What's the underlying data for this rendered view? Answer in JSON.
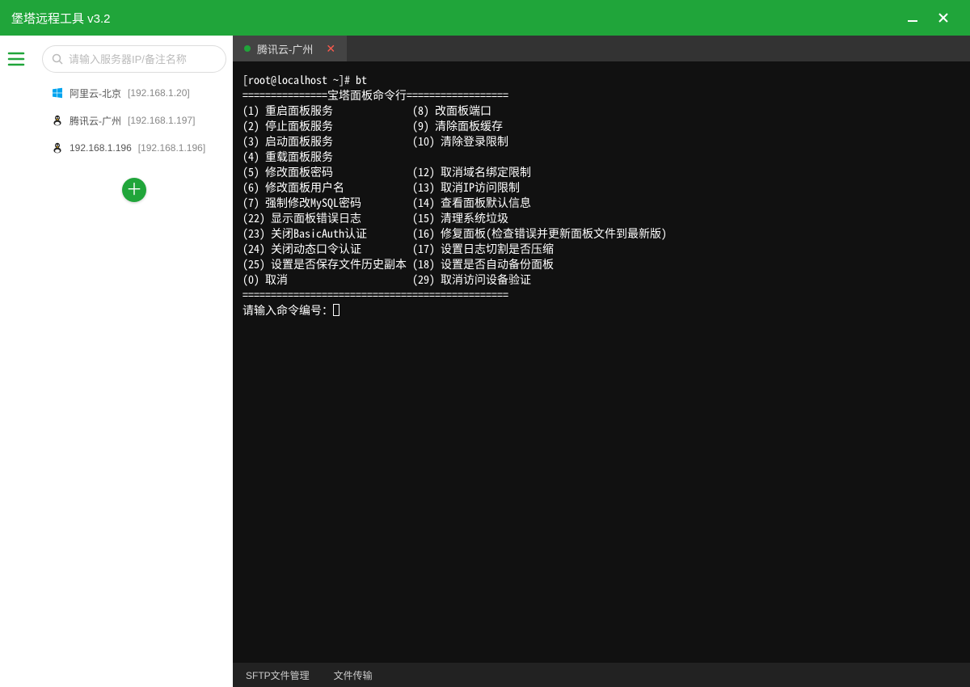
{
  "colors": {
    "accent": "#20a53a",
    "term_bg": "#111111"
  },
  "titlebar": {
    "title": "堡塔远程工具 v3.2"
  },
  "search": {
    "placeholder": "请输入服务器IP/备注名称"
  },
  "servers": [
    {
      "os": "windows",
      "name": "阿里云-北京",
      "ip": "192.168.1.20"
    },
    {
      "os": "linux",
      "name": "腾讯云-广州",
      "ip": "192.168.1.197"
    },
    {
      "os": "linux",
      "name": "192.168.1.196",
      "ip": "192.168.1.196"
    }
  ],
  "tab": {
    "label": "腾讯云-广州"
  },
  "terminal": {
    "prompt": "[root@localhost ~]# bt",
    "header": "===============宝塔面板命令行==================",
    "rows": [
      {
        "l": "(1) 重启面板服务",
        "r": "(8) 改面板端口"
      },
      {
        "l": "(2) 停止面板服务",
        "r": "(9) 清除面板缓存"
      },
      {
        "l": "(3) 启动面板服务",
        "r": "(10) 清除登录限制"
      },
      {
        "l": "(4) 重载面板服务",
        "r": ""
      },
      {
        "l": "(5) 修改面板密码",
        "r": "(12) 取消域名绑定限制"
      },
      {
        "l": "(6) 修改面板用户名",
        "r": "(13) 取消IP访问限制"
      },
      {
        "l": "(7) 强制修改MySQL密码",
        "r": "(14) 查看面板默认信息"
      },
      {
        "l": "(22) 显示面板错误日志",
        "r": "(15) 清理系统垃圾"
      },
      {
        "l": "(23) 关闭BasicAuth认证",
        "r": "(16) 修复面板(检查错误并更新面板文件到最新版)"
      },
      {
        "l": "(24) 关闭动态口令认证",
        "r": "(17) 设置日志切割是否压缩"
      },
      {
        "l": "(25) 设置是否保存文件历史副本",
        "r": "(18) 设置是否自动备份面板"
      },
      {
        "l": "(0) 取消",
        "r": "(29) 取消访问设备验证"
      }
    ],
    "footer_rule": "===============================================",
    "input_prompt": "请输入命令编号："
  },
  "footer": {
    "left": "SFTP文件管理",
    "right": "文件传输"
  }
}
